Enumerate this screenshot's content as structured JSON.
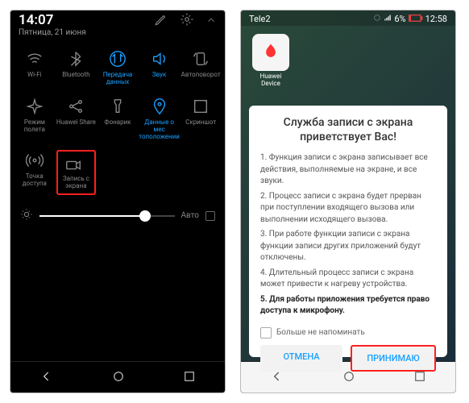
{
  "left": {
    "time": "14:07",
    "date": "Пятница, 21 июня",
    "toggles": [
      {
        "label": "Wi-Fi",
        "icon": "wifi",
        "active": false
      },
      {
        "label": "Bluetooth",
        "icon": "bluetooth",
        "active": false
      },
      {
        "label": "Передача\nданных",
        "icon": "data",
        "active": true
      },
      {
        "label": "Звук",
        "icon": "sound",
        "active": true
      },
      {
        "label": "Автоповорот",
        "icon": "rotate",
        "active": false
      },
      {
        "label": "Режим полета",
        "icon": "airplane",
        "active": false
      },
      {
        "label": "Huawei Share",
        "icon": "share",
        "active": false
      },
      {
        "label": "Фонарик",
        "icon": "torch",
        "active": false
      },
      {
        "label": "Данные о мес\nтоположении",
        "icon": "location",
        "active": true
      },
      {
        "label": "Скриншот",
        "icon": "screenshot",
        "active": false
      },
      {
        "label": "Точка доступа",
        "icon": "hotspot",
        "active": false
      },
      {
        "label": "Запись с\nэкрана",
        "icon": "record",
        "active": false,
        "hl": true
      }
    ],
    "brightness_auto": "Авто"
  },
  "right": {
    "carrier": "Tele2",
    "battery": "6%",
    "time": "12:58",
    "app": {
      "name": "Huawei\nDevice"
    },
    "dialog": {
      "title": "Служба записи с экрана приветствует Вас!",
      "p1": "1. Функция записи с экрана записывает все действия, выполняемые на экране, и все звуки.",
      "p2": "2. Процесс записи с экрана будет прерван при поступлении входящего вызова или выполнении исходящего вызова.",
      "p3": "3. При работе функции записи с экрана функции записи других приложений будут отключены.",
      "p4": "4. Длительный процесс записи с экрана может привести к нагреву устройства.",
      "p5": "5. Для работы приложения требуется право доступа к микрофону.",
      "dontask": "Больше не напоминать",
      "cancel": "ОТМЕНА",
      "accept": "ПРИНИМАЮ"
    }
  }
}
